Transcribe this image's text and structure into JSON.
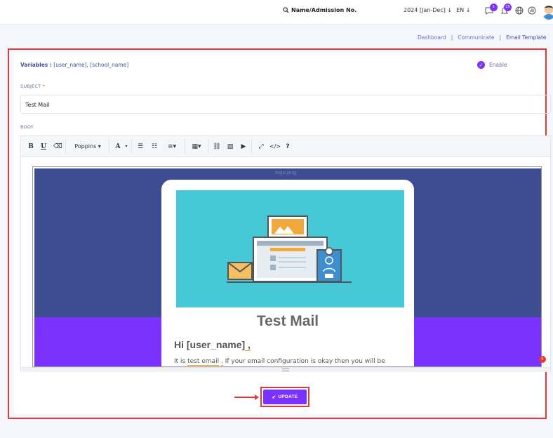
{
  "header": {
    "search_label": "Name/Admission No.",
    "session": "2024 [Jan-Dec]",
    "language": "EN",
    "chat_count": "1",
    "notify_count": "25"
  },
  "breadcrumb": {
    "items": [
      "Dashboard",
      "Communicate",
      "Email Template"
    ]
  },
  "form": {
    "variables_label": "Variables :",
    "variables_value": "[user_name], [school_name]",
    "enable_label": "Enable",
    "subject_label": "SUBJECT",
    "subject_required": "*",
    "subject_value": "Test Mail",
    "body_label": "BODY",
    "update_label": "UPDATE"
  },
  "editor": {
    "font_select": "Poppins",
    "logo_alt": "logo.png",
    "mail_title": "Test Mail",
    "greeting_prefix": "Hi ",
    "greeting_var": "[user_name]",
    "greeting_suffix": " ,",
    "body_p1": "It is ",
    "body_p2": "test email",
    "body_p3": " ",
    "body_p4": ".",
    "body_p5": " If your email configuration is okay then you will be"
  },
  "scroll_badge": "5",
  "colors": {
    "accent": "#7c32ff",
    "navy": "#3e4d92",
    "hero": "#47c8d6",
    "alert": "#e53935"
  }
}
